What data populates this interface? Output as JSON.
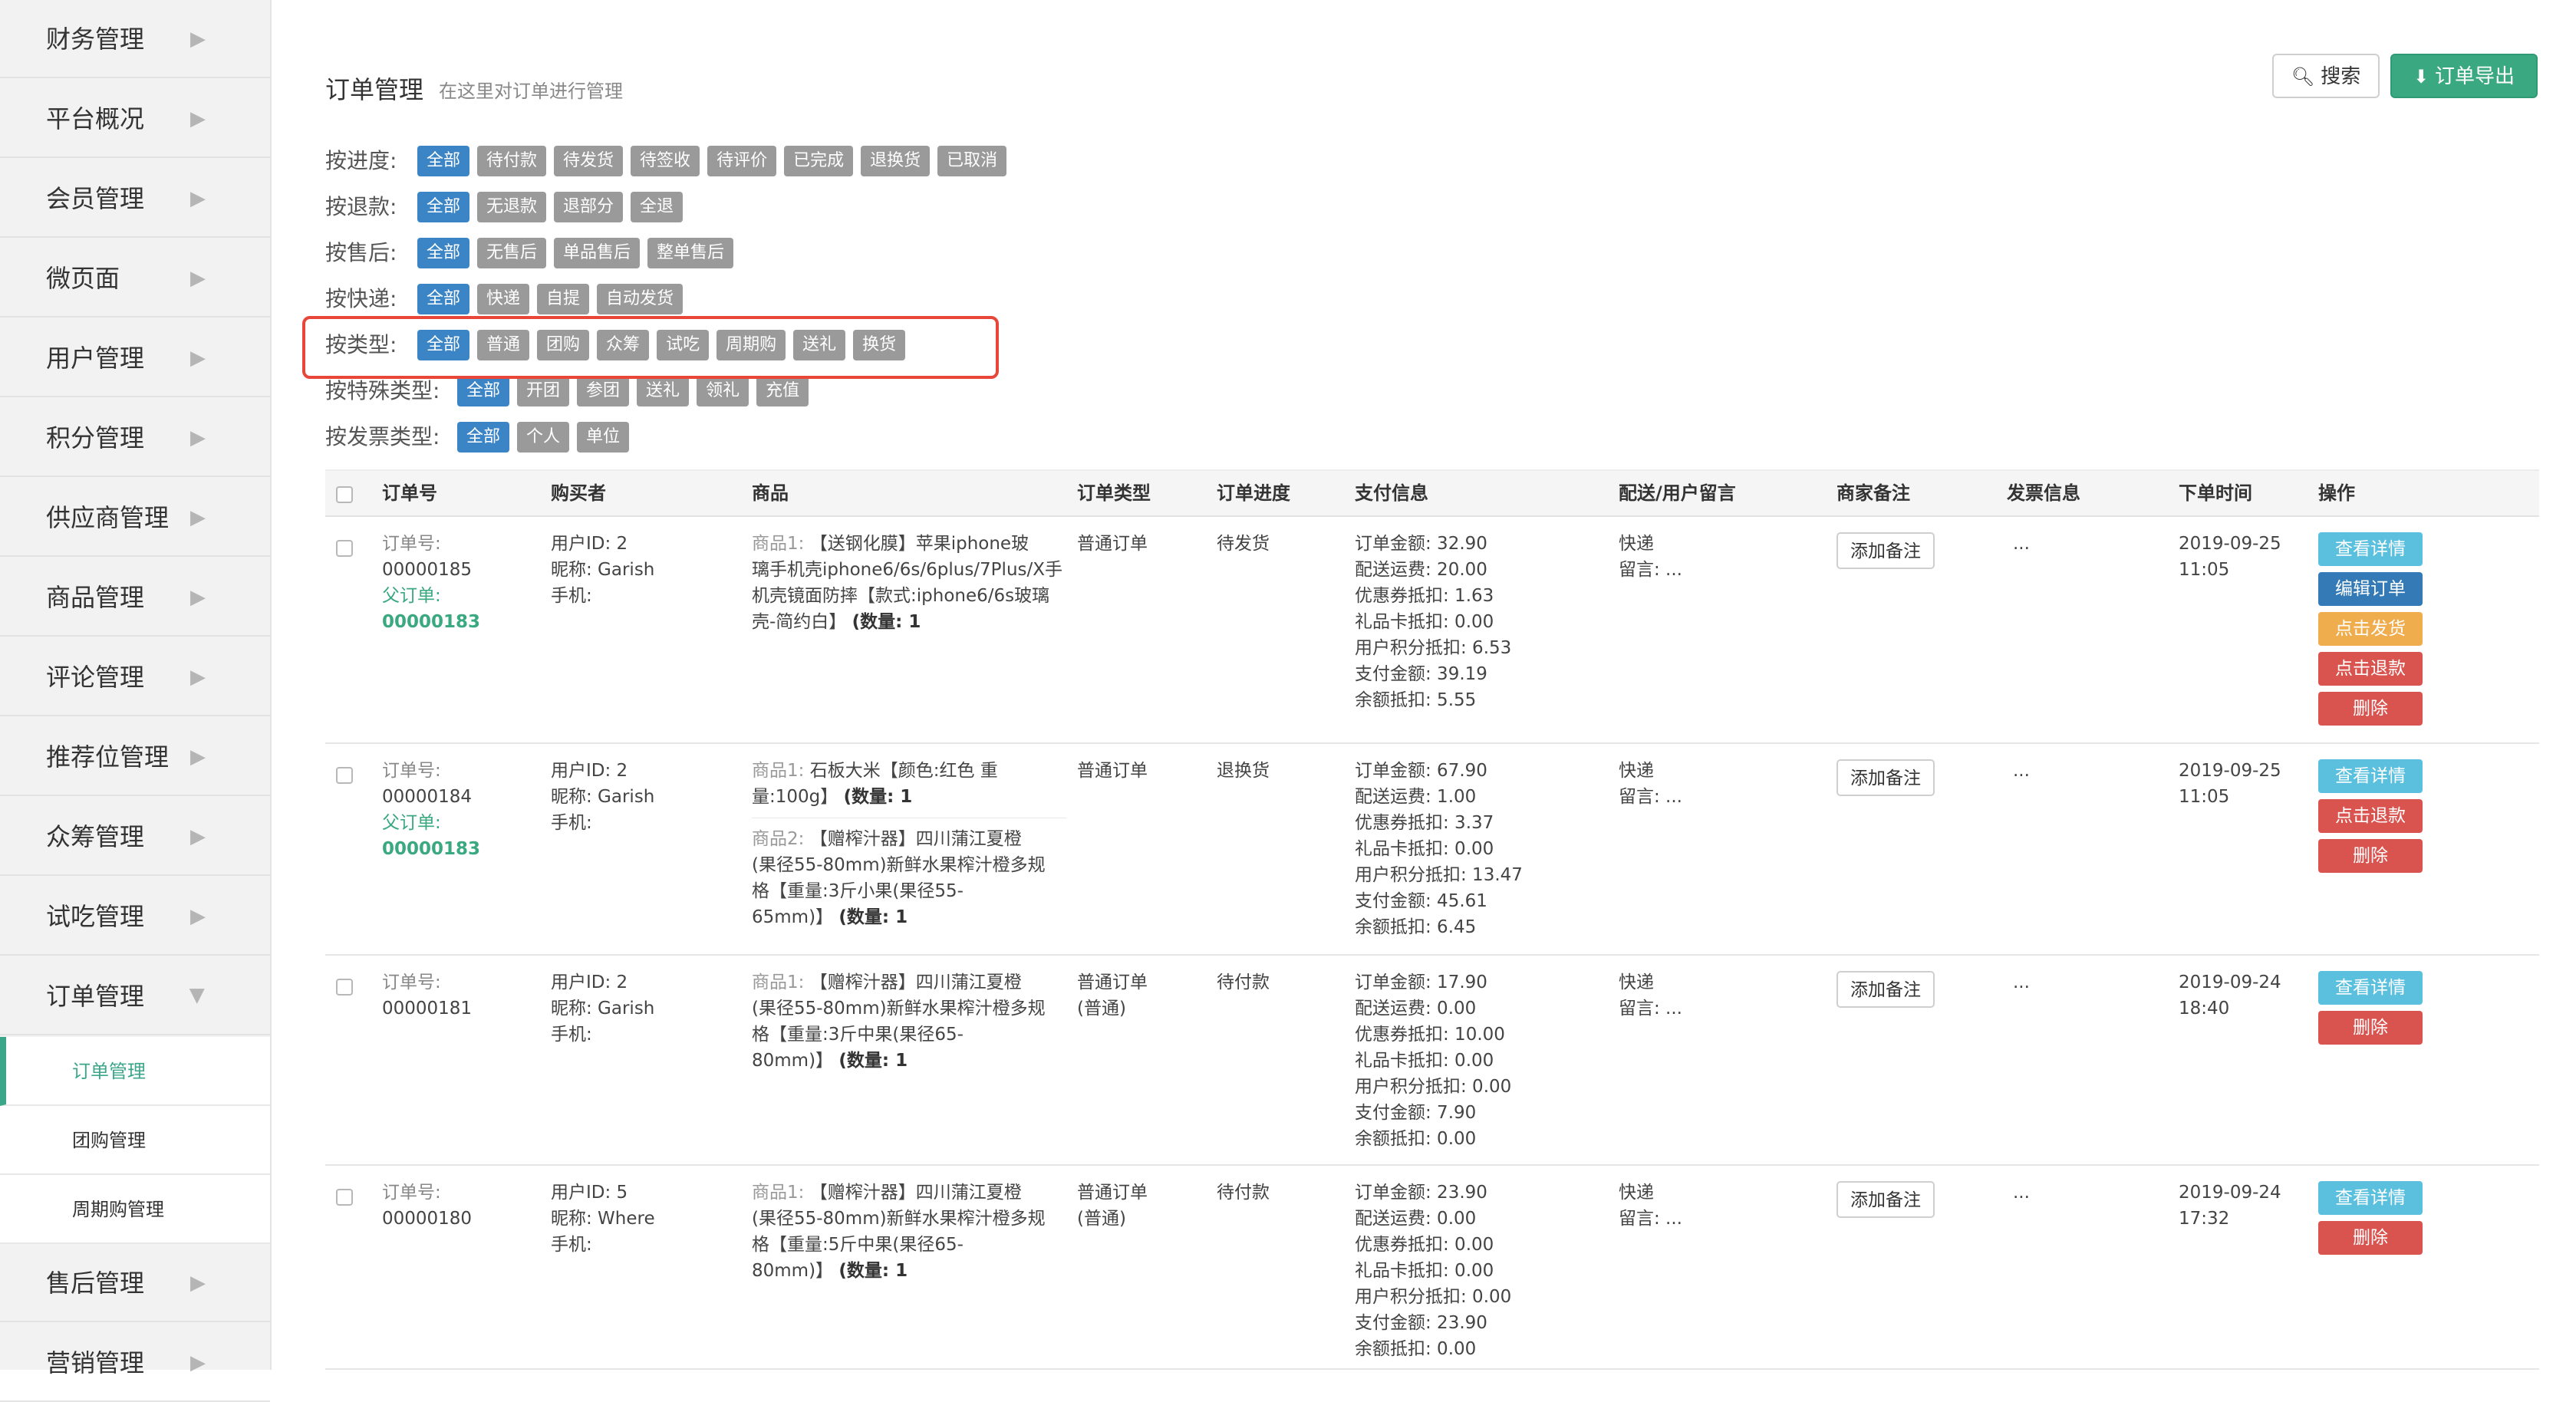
{
  "sidebar": {
    "items": [
      {
        "label": "财务管理"
      },
      {
        "label": "平台概况"
      },
      {
        "label": "会员管理"
      },
      {
        "label": "微页面"
      },
      {
        "label": "用户管理"
      },
      {
        "label": "积分管理"
      },
      {
        "label": "供应商管理"
      },
      {
        "label": "商品管理"
      },
      {
        "label": "评论管理"
      },
      {
        "label": "推荐位管理"
      },
      {
        "label": "众筹管理"
      },
      {
        "label": "试吃管理"
      },
      {
        "label": "订单管理"
      }
    ],
    "sub_items": [
      {
        "label": "订单管理"
      },
      {
        "label": "团购管理"
      },
      {
        "label": "周期购管理"
      }
    ],
    "after_items": [
      {
        "label": "售后管理"
      },
      {
        "label": "营销管理"
      }
    ],
    "arrow_glyph": "▶"
  },
  "header": {
    "title": "订单管理",
    "subtitle": "在这里对订单进行管理",
    "search_label": "搜索",
    "export_label": "订单导出"
  },
  "filters": [
    {
      "label": "按进度:",
      "tags": [
        "全部",
        "待付款",
        "待发货",
        "待签收",
        "待评价",
        "已完成",
        "退换货",
        "已取消"
      ]
    },
    {
      "label": "按退款:",
      "tags": [
        "全部",
        "无退款",
        "退部分",
        "全退"
      ]
    },
    {
      "label": "按售后:",
      "tags": [
        "全部",
        "无售后",
        "单品售后",
        "整单售后"
      ]
    },
    {
      "label": "按快递:",
      "tags": [
        "全部",
        "快递",
        "自提",
        "自动发货"
      ]
    },
    {
      "label": "按类型:",
      "tags": [
        "全部",
        "普通",
        "团购",
        "众筹",
        "试吃",
        "周期购",
        "送礼",
        "换货"
      ]
    },
    {
      "label": "按特殊类型:",
      "tags": [
        "全部",
        "开团",
        "参团",
        "送礼",
        "领礼",
        "充值"
      ]
    },
    {
      "label": "按发票类型:",
      "tags": [
        "全部",
        "个人",
        "单位"
      ]
    }
  ],
  "table": {
    "headers": [
      "订单号",
      "购买者",
      "商品",
      "订单类型",
      "订单进度",
      "支付信息",
      "配送/用户留言",
      "商家备注",
      "发票信息",
      "下单时间",
      "操作"
    ],
    "note_button": "添加备注",
    "rows": [
      {
        "order_label": "订单号:",
        "order_no": "00000185",
        "parent_label": "父订单:",
        "parent_no": "00000183",
        "buyer": [
          "用户ID: 2",
          "昵称: Garish",
          "手机:"
        ],
        "goods": [
          {
            "tag": "商品1:",
            "lines": [
              "【送钢化膜】苹果iphone玻",
              "璃手机壳iphone6/6s/6plus/7Plus/X手",
              "机壳镜面防摔【款式:iphone6/6s玻璃",
              "壳-简约白】"
            ],
            "qty": "(数量: 1"
          }
        ],
        "type": [
          "普通订单"
        ],
        "progress": "待发货",
        "pay": [
          "订单金额: 32.90",
          "配送运费: 20.00",
          "优惠券抵扣: 1.63",
          "礼品卡抵扣: 0.00",
          "用户积分抵扣: 6.53",
          "支付金额: 39.19",
          "余额抵扣: 5.55"
        ],
        "delivery": [
          "快递",
          "留言: ..."
        ],
        "invoice": "...",
        "time": [
          "2019-09-25",
          "11:05"
        ],
        "ops": [
          {
            "label": "查看详情",
            "style": "info"
          },
          {
            "label": "编辑订单",
            "style": "primary"
          },
          {
            "label": "点击发货",
            "style": "warning"
          },
          {
            "label": "点击退款",
            "style": "danger"
          },
          {
            "label": "删除",
            "style": "danger"
          }
        ]
      },
      {
        "order_label": "订单号:",
        "order_no": "00000184",
        "parent_label": "父订单:",
        "parent_no": "00000183",
        "buyer": [
          "用户ID: 2",
          "昵称: Garish",
          "手机:"
        ],
        "goods": [
          {
            "tag": "商品1:",
            "lines": [
              "石板大米【颜色:红色 重",
              "量:100g】"
            ],
            "qty": "(数量: 1"
          },
          {
            "tag": "商品2:",
            "lines": [
              "【赠榨汁器】四川蒲江夏橙",
              "(果径55-80mm)新鲜水果榨汁橙多规",
              "格【重量:3斤小果(果径55-",
              "65mm)】"
            ],
            "qty": "(数量: 1"
          }
        ],
        "type": [
          "普通订单"
        ],
        "progress": "退换货",
        "pay": [
          "订单金额: 67.90",
          "配送运费: 1.00",
          "优惠券抵扣: 3.37",
          "礼品卡抵扣: 0.00",
          "用户积分抵扣: 13.47",
          "支付金额: 45.61",
          "余额抵扣: 6.45"
        ],
        "delivery": [
          "快递",
          "留言: ..."
        ],
        "invoice": "...",
        "time": [
          "2019-09-25",
          "11:05"
        ],
        "ops": [
          {
            "label": "查看详情",
            "style": "info"
          },
          {
            "label": "点击退款",
            "style": "danger"
          },
          {
            "label": "删除",
            "style": "danger"
          }
        ]
      },
      {
        "order_label": "订单号:",
        "order_no": "00000181",
        "parent_label": "",
        "parent_no": "",
        "buyer": [
          "用户ID: 2",
          "昵称: Garish",
          "手机:"
        ],
        "goods": [
          {
            "tag": "商品1:",
            "lines": [
              "【赠榨汁器】四川蒲江夏橙",
              "(果径55-80mm)新鲜水果榨汁橙多规",
              "格【重量:3斤中果(果径65-",
              "80mm)】"
            ],
            "qty": "(数量: 1"
          }
        ],
        "type": [
          "普通订单",
          "(普通)"
        ],
        "progress": "待付款",
        "pay": [
          "订单金额: 17.90",
          "配送运费: 0.00",
          "优惠券抵扣: 10.00",
          "礼品卡抵扣: 0.00",
          "用户积分抵扣: 0.00",
          "支付金额: 7.90",
          "余额抵扣: 0.00"
        ],
        "delivery": [
          "快递",
          "留言: ..."
        ],
        "invoice": "...",
        "time": [
          "2019-09-24",
          "18:40"
        ],
        "ops": [
          {
            "label": "查看详情",
            "style": "info"
          },
          {
            "label": "删除",
            "style": "danger"
          }
        ]
      },
      {
        "order_label": "订单号:",
        "order_no": "00000180",
        "parent_label": "",
        "parent_no": "",
        "buyer": [
          "用户ID: 5",
          "昵称: Where",
          "手机:"
        ],
        "goods": [
          {
            "tag": "商品1:",
            "lines": [
              "【赠榨汁器】四川蒲江夏橙",
              "(果径55-80mm)新鲜水果榨汁橙多规",
              "格【重量:5斤中果(果径65-",
              "80mm)】"
            ],
            "qty": "(数量: 1"
          }
        ],
        "type": [
          "普通订单",
          "(普通)"
        ],
        "progress": "待付款",
        "pay": [
          "订单金额: 23.90",
          "配送运费: 0.00",
          "优惠券抵扣: 0.00",
          "礼品卡抵扣: 0.00",
          "用户积分抵扣: 0.00",
          "支付金额: 23.90",
          "余额抵扣: 0.00"
        ],
        "delivery": [
          "快递",
          "留言: ..."
        ],
        "invoice": "...",
        "time": [
          "2019-09-24",
          "17:32"
        ],
        "ops": [
          {
            "label": "查看详情",
            "style": "info"
          },
          {
            "label": "删除",
            "style": "danger"
          }
        ]
      }
    ]
  },
  "colors": {
    "accent_green": "#3aa880",
    "tag_active": "#3b84c6",
    "tag_inactive": "#9a9a9a",
    "highlight": "#e9463a"
  }
}
